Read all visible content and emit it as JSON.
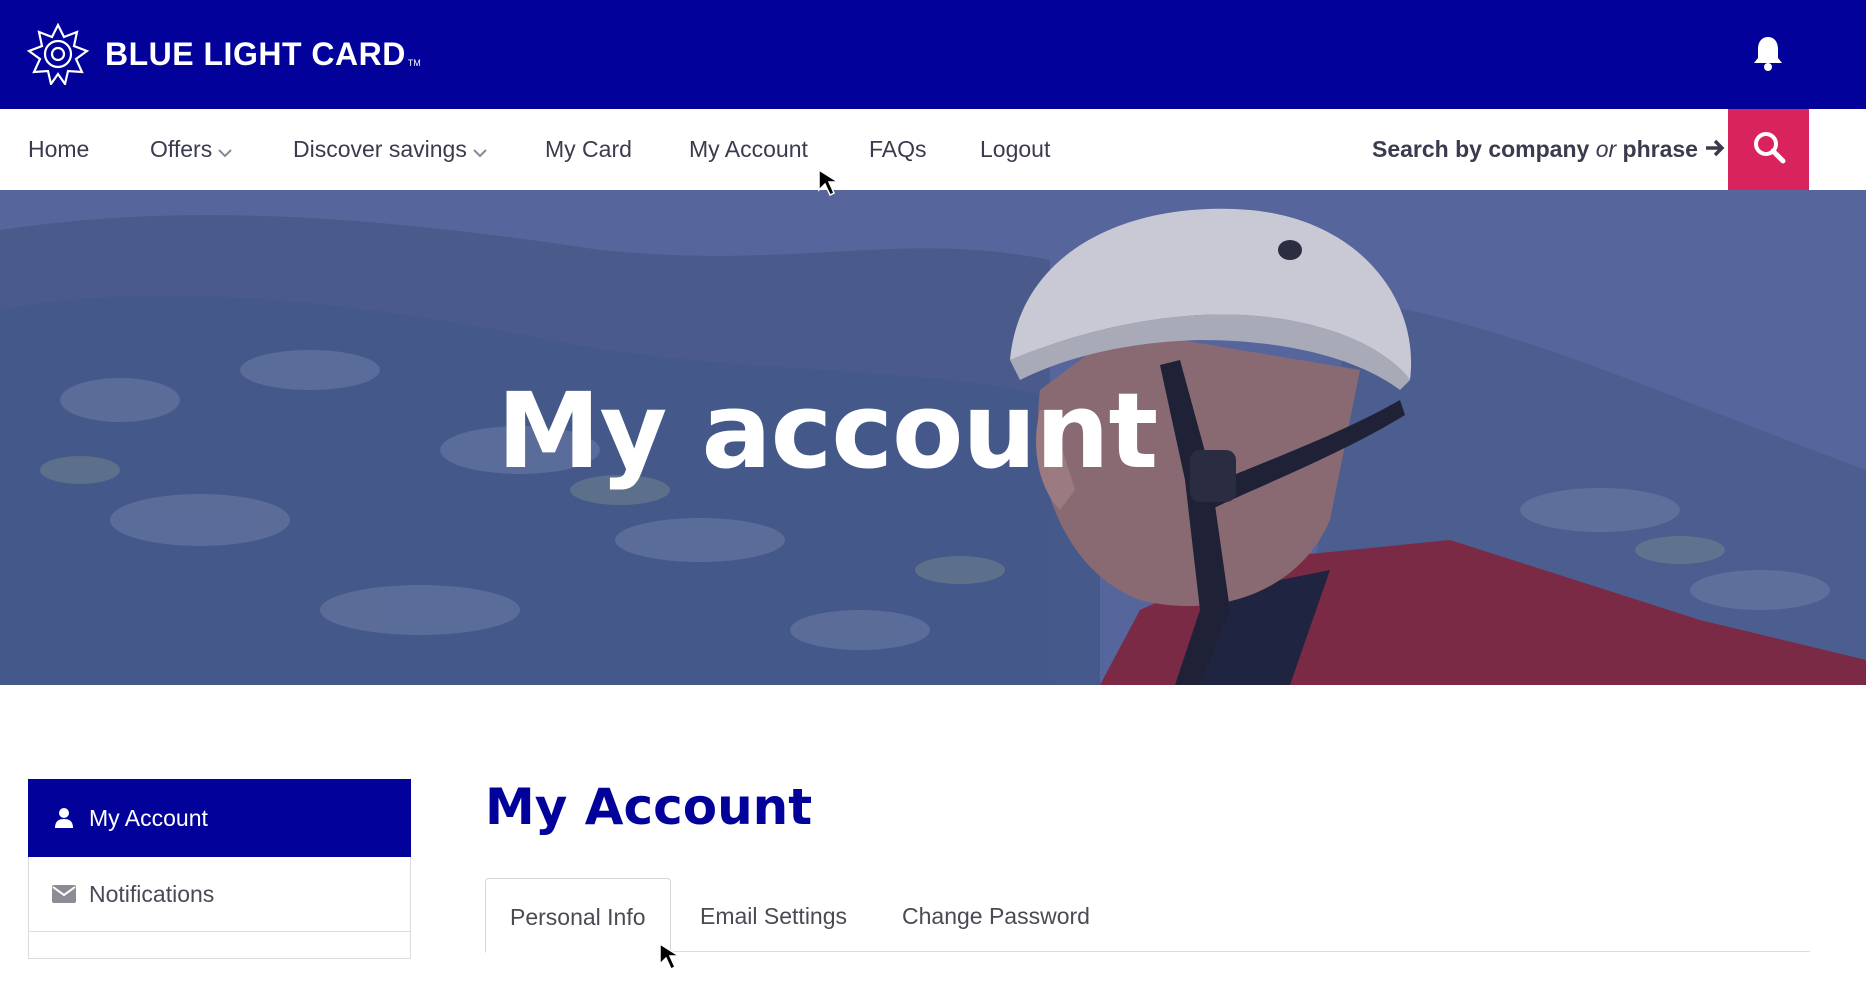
{
  "header": {
    "brand": "BLUE LIGHT CARD",
    "brand_tm": "TM",
    "logo_icon": "star-badge-icon",
    "notification_icon": "bell-icon"
  },
  "nav": {
    "items": [
      {
        "label": "Home"
      },
      {
        "label": "Offers",
        "has_dropdown": true
      },
      {
        "label": "Discover savings",
        "has_dropdown": true
      },
      {
        "label": "My Card"
      },
      {
        "label": "My Account"
      },
      {
        "label": "FAQs"
      },
      {
        "label": "Logout"
      }
    ],
    "search_hint_pre": "Search by company",
    "search_hint_or": "or",
    "search_hint_post": "phrase",
    "search_icon": "search-icon"
  },
  "hero": {
    "title": "My account"
  },
  "sidebar": {
    "items": [
      {
        "label": "My Account",
        "icon": "user-icon",
        "active": true
      },
      {
        "label": "Notifications",
        "icon": "envelope-icon",
        "active": false
      }
    ]
  },
  "main": {
    "title": "My Account",
    "tabs": [
      {
        "label": "Personal Info",
        "active": true
      },
      {
        "label": "Email Settings",
        "active": false
      },
      {
        "label": "Change Password",
        "active": false
      }
    ]
  },
  "colors": {
    "brand_blue": "#02029a",
    "search_pink": "#d9235c",
    "nav_text": "#3b3b4f"
  }
}
